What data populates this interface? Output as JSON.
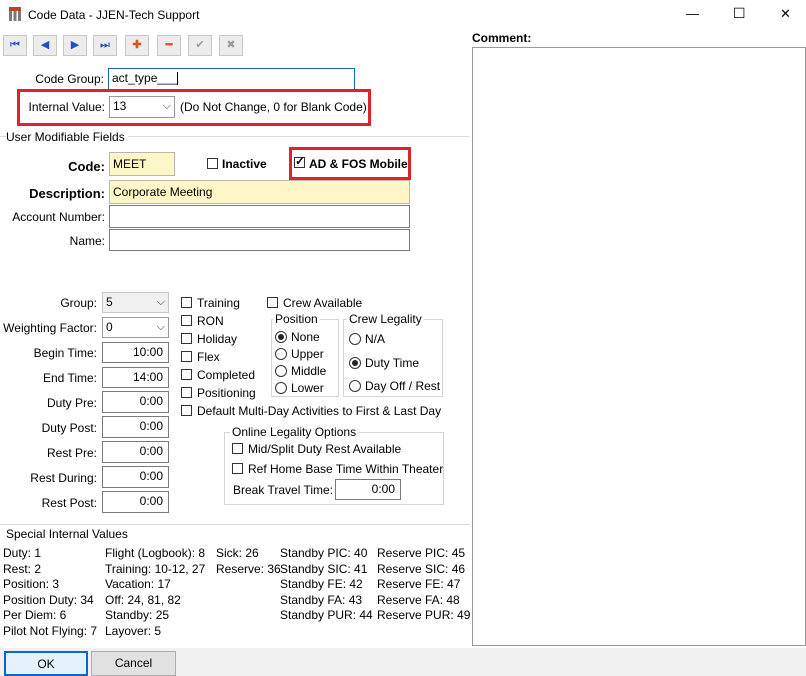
{
  "window": {
    "title": "Code Data - JJEN-Tech Support",
    "minimize_label": "—",
    "maximize_label": "☐",
    "close_label": "✕"
  },
  "toolbar": {
    "first_icon": "⏮",
    "prev_icon": "◀",
    "next_icon": "▶",
    "last_icon": "⏭",
    "add_icon": "✚",
    "delete_icon": "━",
    "confirm_icon": "✔",
    "cancel_icon": "✖"
  },
  "form": {
    "code_group_label": "Code Group:",
    "code_group_value": "act_type___",
    "internal_value_label": "Internal Value:",
    "internal_value": "13",
    "internal_value_hint": "(Do Not Change, 0 for Blank Code)",
    "user_fields_title": "User Modifiable Fields",
    "code_label": "Code:",
    "code_value": "MEET",
    "inactive_label": "Inactive",
    "inactive_checked": false,
    "ad_fos_label": "AD & FOS Mobile",
    "ad_fos_checked": true,
    "description_label": "Description:",
    "description_value": "Corporate Meeting",
    "account_label": "Account Number:",
    "account_value": "",
    "name_label": "Name:",
    "name_value": ""
  },
  "settings": {
    "group_label": "Group:",
    "group_value": "5",
    "weighting_label": "Weighting Factor:",
    "weighting_value": "0",
    "begin_label": "Begin Time:",
    "begin_value": "10:00",
    "end_label": "End Time:",
    "end_value": "14:00",
    "duty_pre_label": "Duty Pre:",
    "duty_pre_value": "0:00",
    "duty_post_label": "Duty Post:",
    "duty_post_value": "0:00",
    "rest_pre_label": "Rest Pre:",
    "rest_pre_value": "0:00",
    "rest_during_label": "Rest During:",
    "rest_during_value": "0:00",
    "rest_post_label": "Rest Post:",
    "rest_post_value": "0:00"
  },
  "flags": {
    "training": "Training",
    "ron": "RON",
    "holiday": "Holiday",
    "flex": "Flex",
    "completed": "Completed",
    "positioning": "Positioning",
    "crew_available": "Crew Available",
    "default_multi_day": "Default Multi-Day Activities to First & Last Day"
  },
  "position_group": {
    "title": "Position",
    "options": [
      "None",
      "Upper",
      "Middle",
      "Lower"
    ],
    "selected": "None"
  },
  "crew_legality_group": {
    "title": "Crew Legality",
    "options": [
      "N/A",
      "Duty Time",
      "Day Off / Rest"
    ],
    "selected": "Duty Time"
  },
  "online_legality": {
    "title": "Online Legality Options",
    "mid_split": "Mid/Split Duty Rest Available",
    "ref_home": "Ref Home Base Time Within Theater",
    "break_travel_label": "Break Travel Time:",
    "break_travel_value": "0:00"
  },
  "special": {
    "title": "Special Internal Values",
    "col1": [
      "Duty: 1",
      "Rest: 2",
      "Position: 3",
      "Position Duty: 34",
      "Per Diem: 6",
      "Pilot Not Flying: 7"
    ],
    "col2": [
      "Flight (Logbook): 8",
      "Training: 10-12, 27",
      "Vacation: 17",
      "Off: 24, 81, 82",
      "Standby: 25",
      "Layover: 5"
    ],
    "col3": [
      "Sick: 26",
      "Reserve: 36"
    ],
    "col4": [
      "Standby PIC: 40",
      "Standby SIC: 41",
      "Standby FE: 42",
      "Standby FA: 43",
      "Standby PUR: 44"
    ],
    "col5": [
      "Reserve PIC: 45",
      "Reserve SIC: 46",
      "Reserve FE: 47",
      "Reserve FA: 48",
      "Reserve PUR: 49"
    ]
  },
  "comment": {
    "label": "Comment:",
    "value": ""
  },
  "buttons": {
    "ok": "OK",
    "cancel": "Cancel"
  }
}
